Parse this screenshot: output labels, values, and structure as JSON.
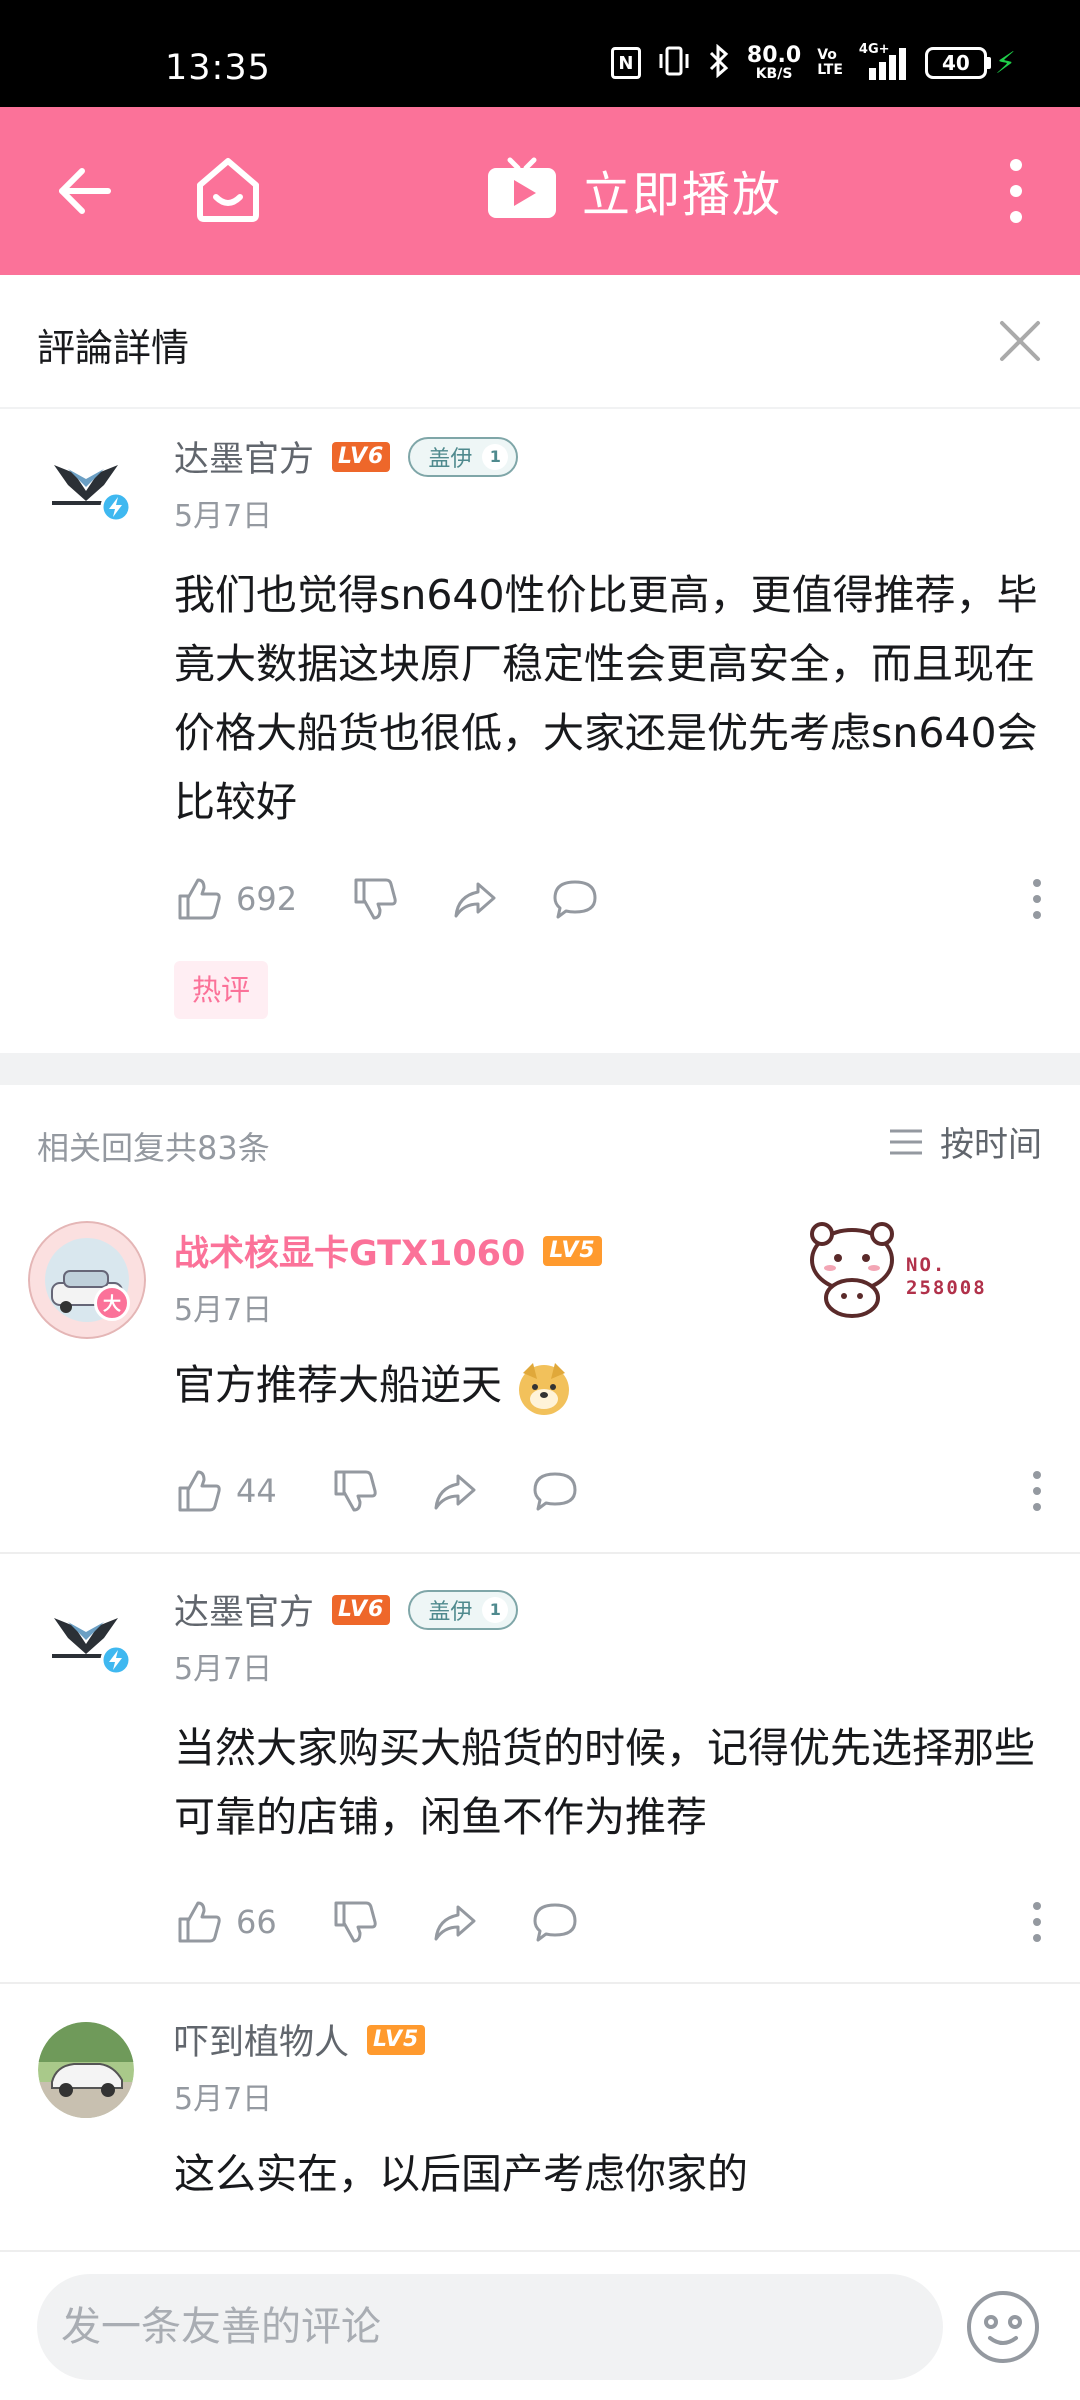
{
  "status_bar": {
    "time": "13:35",
    "nfc": "N",
    "speed_value": "80.0",
    "speed_unit": "KB/S",
    "volte_top": "Vo",
    "volte_bottom": "LTE",
    "network": "4G+",
    "battery": "40"
  },
  "topnav": {
    "play_label": "立即播放",
    "icons": [
      "back-arrow-icon",
      "home-icon",
      "tv-play-icon",
      "more-vertical-icon"
    ]
  },
  "detail": {
    "title": "評論詳情"
  },
  "root_comment": {
    "username": "达墨官方",
    "level": "LV6",
    "fan_badge": "盖伊",
    "fan_badge_level": "1",
    "date": "5月7日",
    "text": "我们也觉得sn640性价比更高，更值得推荐，毕竟大数据这块原厂稳定性会更高安全，而且现在价格大船货也很低，大家还是优先考虑sn640会比较好",
    "likes": "692",
    "tag": "热评"
  },
  "replies": {
    "count_label": "相关回复共83条",
    "sort_label": "按时间",
    "items": [
      {
        "username": "战术核显卡GTX1060",
        "level": "LV5",
        "date": "5月7日",
        "text": "官方推荐大船逆天",
        "likes": "44",
        "decoration_no": "NO.",
        "decoration_num": "258008",
        "avatar_badge": "大"
      },
      {
        "username": "达墨官方",
        "level": "LV6",
        "fan_badge": "盖伊",
        "fan_badge_level": "1",
        "date": "5月7日",
        "text": "当然大家购买大船货的时候，记得优先选择那些可靠的店铺，闲鱼不作为推荐",
        "likes": "66"
      },
      {
        "username": "吓到植物人",
        "level": "LV5",
        "date": "5月7日",
        "text": "这么实在，以后国产考虑你家的"
      }
    ]
  },
  "bottom": {
    "input_placeholder": "发一条友善的评论"
  },
  "colors": {
    "brand_pink": "#fb7299",
    "level6": "#ee672a",
    "level5": "#ff9a2e",
    "text_grey": "#9499a0"
  }
}
